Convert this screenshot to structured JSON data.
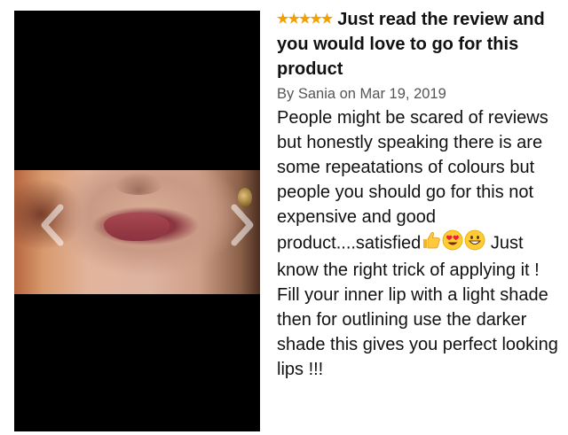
{
  "review": {
    "rating_stars": "★★★★★",
    "title": "Just read the review and you would love to go for this product",
    "author_line": "By Sania on Mar 19, 2019",
    "body_part1": "People might be scared of reviews but honestly speaking there is are some repeatations of colours but people you should go for this not expensive and good product....satisfied",
    "body_part2": "Just know the right trick of applying it ! Fill your inner lip with a light shade then for outlining use the darker shade this gives you perfect looking lips !!!"
  },
  "icons": {
    "emoji_1": "thumbs-up-icon",
    "emoji_2": "heart-eyes-icon",
    "emoji_3": "grinning-face-icon",
    "prev": "chevron-left-icon",
    "next": "chevron-right-icon"
  },
  "colors": {
    "star": "#f4a000",
    "viewer_background": "#000000",
    "meta_text": "#555555"
  }
}
